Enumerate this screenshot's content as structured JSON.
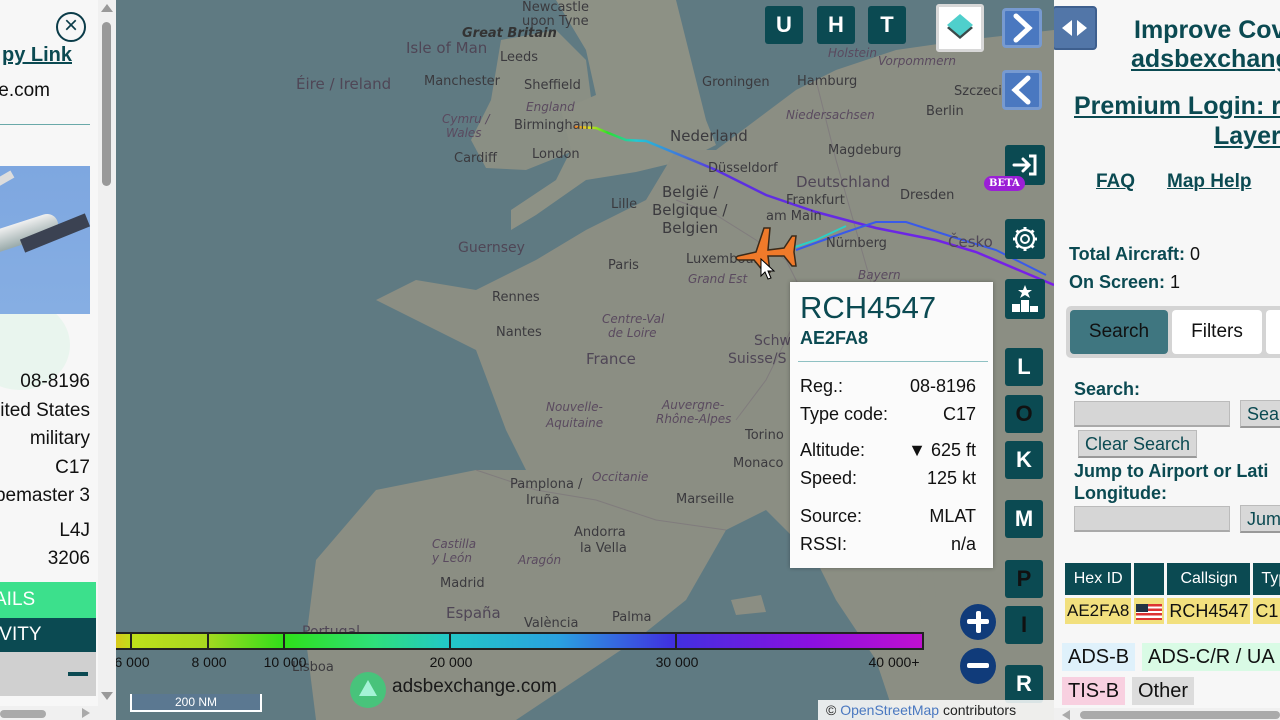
{
  "left_panel": {
    "close_icon": "close-circle-icon",
    "copy_link": "py Link",
    "domain": "e.com",
    "details": [
      "08-8196",
      "ited States",
      "military",
      "C17",
      "pemaster 3",
      "L4J",
      "3206"
    ],
    "details_button": "AILS",
    "activity_button": "IVITY",
    "collapse_icon": "minus-icon"
  },
  "map": {
    "labels": {
      "newcastle": "Newcastle",
      "upon_tyne": "upon Tyne",
      "great_britain": "Great Britain",
      "isle_of_man": "Isle of Man",
      "leeds": "Leeds",
      "eire": "Éire / Ireland",
      "manchester": "Manchester",
      "sheffield": "Sheffield",
      "england": "England",
      "cymru": "Cymru /",
      "wales": "Wales",
      "birmingham": "Birmingham",
      "cardiff": "Cardiff",
      "london": "London",
      "guernsey": "Guernsey",
      "rennes": "Rennes",
      "nantes": "Nantes",
      "paris": "Paris",
      "lille": "Lille",
      "belgie1": "België /",
      "belgie2": "Belgique /",
      "belgie3": "Belgien",
      "nederland": "Nederland",
      "groningen": "Groningen",
      "dusseldorf": "Düsseldorf",
      "hamburg": "Hamburg",
      "niedersachsen": "Niedersachsen",
      "berlin": "Berlin",
      "szczecin": "Szczecin",
      "magdeburg": "Magdeburg",
      "deutschland": "Deutschland",
      "frankfurt1": "Frankfurt",
      "frankfurt2": "am Main",
      "dresden": "Dresden",
      "nurnberg": "Nürnberg",
      "cesko": "Česko",
      "bayern": "Bayern",
      "luxembourg": "Luxembourg",
      "grand_est": "Grand Est",
      "centre1": "Centre-Val",
      "centre2": "de Loire",
      "france": "France",
      "schw": "Schw",
      "suisse": "Suisse/S",
      "nouvelle1": "Nouvelle-",
      "nouvelle2": "Aquitaine",
      "auvergne1": "Auvergne-",
      "auvergne2": "Rhône-Alpes",
      "torino": "Torino",
      "monaco": "Monaco",
      "occitanie": "Occitanie",
      "marseille": "Marseille",
      "pamplona1": "Pamplona /",
      "pamplona2": "Iruña",
      "andorra1": "Andorra",
      "andorra2": "la Vella",
      "castilla1": "Castilla",
      "castilla2": "y León",
      "aragon": "Aragón",
      "madrid": "Madrid",
      "espana": "España",
      "valencia": "València",
      "palma": "Palma",
      "portugal": "Portugal",
      "lisboa": "Lisboa",
      "vorpommern": "Vorpommern",
      "holstein": "Holstein"
    },
    "top_buttons": [
      "U",
      "H",
      "T"
    ],
    "layers_icon": "layers-icon",
    "next_icon": "chevron-right-icon",
    "prev_icon": "chevron-left-icon",
    "login_icon": "sign-in-icon",
    "beta_badge": "BETA",
    "settings_icon": "gear-icon",
    "leaderboard_icon": "podium-star-icon",
    "side_buttons": [
      "L",
      "O",
      "K",
      "M",
      "P",
      "I",
      "R"
    ],
    "zoom_in_icon": "plus-icon",
    "zoom_out_icon": "minus-icon",
    "altitude_legend": {
      "ticks": [
        "6 000",
        "8 000",
        "10 000",
        "20 000",
        "30 000",
        "40 000+"
      ]
    },
    "scale": "200 NM",
    "watermark": "adsbexchange.com",
    "attribution_prefix": "©",
    "attribution_link": "OpenStreetMap",
    "attribution_suffix": "contributors"
  },
  "popup": {
    "callsign": "RCH4547",
    "hex": "AE2FA8",
    "rows": [
      {
        "label": "Reg.:",
        "value": "08-8196"
      },
      {
        "label": "Type code:",
        "value": "C17"
      },
      {
        "label": "Altitude:",
        "value": "▼ 625 ft"
      },
      {
        "label": "Speed:",
        "value": "125 kt"
      },
      {
        "label": "Source:",
        "value": "MLAT"
      },
      {
        "label": "RSSI:",
        "value": "n/a"
      }
    ]
  },
  "right_panel": {
    "toggle_icon": "left-right-arrows-icon",
    "improve_1": "Improve Cov",
    "improve_2": "adsbexchang",
    "premium_1": "Premium Login: r",
    "premium_2": "Layer",
    "faq": "FAQ",
    "map_help": "Map Help",
    "total_label": "Total Aircraft:",
    "total_value": "0",
    "onscreen_label": "On Screen:",
    "onscreen_value": "1",
    "tabs": [
      "Search",
      "Filters"
    ],
    "search_label": "Search:",
    "search_value": "",
    "search_button": "Sea",
    "clear_button": "Clear Search",
    "jump_label_1": "Jump to Airport or Lati",
    "jump_label_2": "Longitude:",
    "jump_value": "",
    "jump_button": "Jum",
    "table": {
      "headers": [
        "Hex ID",
        "",
        "Callsign",
        "Typ"
      ],
      "rows": [
        {
          "hex": "AE2FA8",
          "flag": "us-flag-icon",
          "callsign": "RCH4547",
          "type": "C1"
        }
      ]
    },
    "source_legend": [
      "ADS-B",
      "ADS-C/R / UA",
      "TIS-B",
      "Other"
    ],
    "colors": {
      "teal": "#0b4a52",
      "ads_b": "#dff1fb",
      "ads_c": "#d9fbe5",
      "tis_b": "#f8d0e0",
      "other": "#dcdcdc",
      "row_highlight": "#f2e07e"
    }
  },
  "aircraft": {
    "icon": "airplane-icon",
    "color": "#f07a2a"
  }
}
